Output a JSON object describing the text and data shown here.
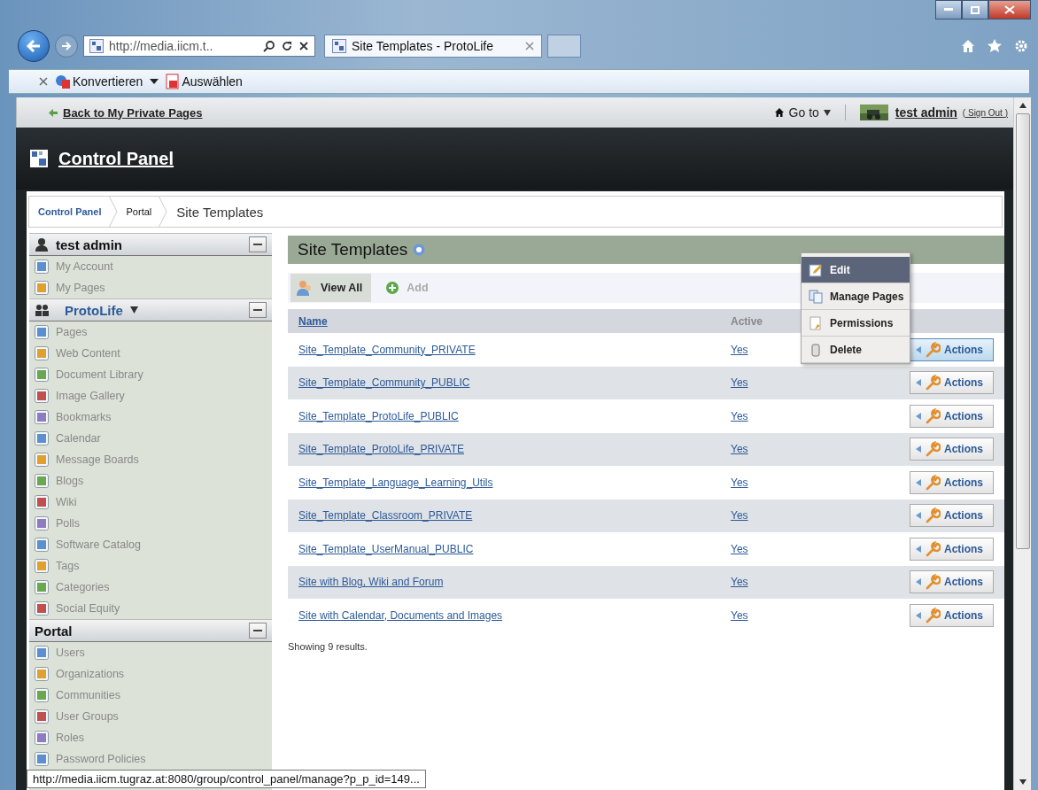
{
  "browser": {
    "address": "http://media.iicm.t..",
    "tabs": [
      {
        "label": "Site Templates - ProtoLife",
        "selected": true
      }
    ],
    "toolbar": [
      "Konvertieren",
      "Auswählen"
    ]
  },
  "dockbar": {
    "back_link": "Back to My Private Pages",
    "goto": "Go to",
    "user": "test admin",
    "sign_out": "( Sign Out )"
  },
  "header": {
    "title": "Control Panel"
  },
  "breadcrumb": [
    "Control Panel",
    "Portal",
    "Site Templates"
  ],
  "sidebar": [
    {
      "title": "test admin",
      "kind": "user",
      "items": [
        "My Account",
        "My Pages"
      ]
    },
    {
      "title": "ProtoLife",
      "kind": "community",
      "items": [
        "Pages",
        "Web Content",
        "Document Library",
        "Image Gallery",
        "Bookmarks",
        "Calendar",
        "Message Boards",
        "Blogs",
        "Wiki",
        "Polls",
        "Software Catalog",
        "Tags",
        "Categories",
        "Social Equity"
      ]
    },
    {
      "title": "Portal",
      "kind": "plain",
      "items": [
        "Users",
        "Organizations",
        "Communities",
        "User Groups",
        "Roles",
        "Password Policies"
      ]
    }
  ],
  "content": {
    "title": "Site Templates",
    "toolbar": [
      {
        "label": "View All",
        "selected": true
      },
      {
        "label": "Add",
        "selected": false
      }
    ],
    "columns": [
      "Name",
      "Active"
    ],
    "rows": [
      {
        "name": "Site_Template_Community_PRIVATE",
        "active": "Yes",
        "action": "Actions",
        "hover": true
      },
      {
        "name": "Site_Template_Community_PUBLIC",
        "active": "Yes",
        "action": "Actions",
        "hover": false
      },
      {
        "name": "Site_Template_ProtoLife_PUBLIC",
        "active": "Yes",
        "action": "Actions",
        "hover": false
      },
      {
        "name": "Site_Template_ProtoLife_PRIVATE",
        "active": "Yes",
        "action": "Actions",
        "hover": false
      },
      {
        "name": "Site_Template_Language_Learning_Utils",
        "active": "Yes",
        "action": "Actions",
        "hover": false
      },
      {
        "name": "Site_Template_Classroom_PRIVATE",
        "active": "Yes",
        "action": "Actions",
        "hover": false
      },
      {
        "name": "Site_Template_UserManual_PUBLIC",
        "active": "Yes",
        "action": "Actions",
        "hover": false
      },
      {
        "name": "Site with Blog, Wiki and Forum",
        "active": "Yes",
        "action": "Actions",
        "hover": false
      },
      {
        "name": "Site with Calendar, Documents and Images",
        "active": "Yes",
        "action": "Actions",
        "hover": false
      }
    ],
    "menu": [
      {
        "label": "Edit",
        "selected": true
      },
      {
        "label": "Manage Pages",
        "selected": false
      },
      {
        "label": "Permissions",
        "selected": false
      },
      {
        "label": "Delete",
        "selected": false
      }
    ],
    "footer": "Showing 9 results."
  },
  "status_tooltip": "http://media.iicm.tugraz.at:8080/group/control_panel/manage?p_p_id=149..."
}
